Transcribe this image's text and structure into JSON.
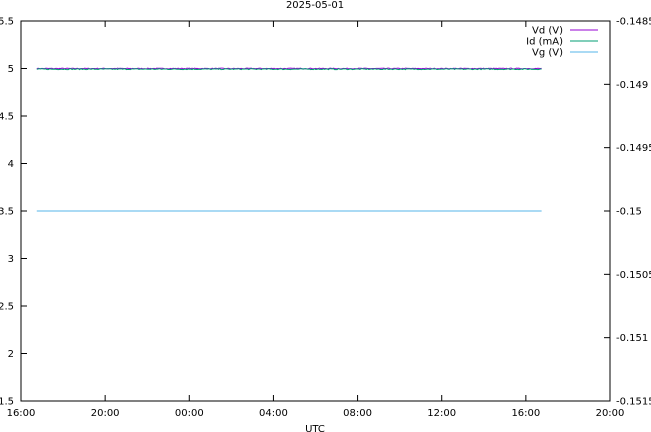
{
  "chart_data": {
    "type": "line",
    "title": "2025-05-01",
    "xlabel": "UTC",
    "x_ticks": [
      "16:00",
      "20:00",
      "00:00",
      "04:00",
      "08:00",
      "12:00",
      "16:00",
      "20:00"
    ],
    "x_range": [
      "2025-04-30T16:00",
      "2025-05-01T20:00"
    ],
    "y_left": {
      "ticks": [
        "1.5",
        "2",
        "2.5",
        "3",
        "3.5",
        "4",
        "4.5",
        "5",
        "5.5"
      ],
      "range": [
        1.5,
        5.5
      ]
    },
    "y_right": {
      "ticks": [
        "-0.1515",
        "-0.151",
        "-0.1505",
        "-0.15",
        "-0.1495",
        "-0.149",
        "-0.1485"
      ],
      "range": [
        -0.1515,
        -0.1485
      ]
    },
    "grid": false,
    "legend_position": "top-right",
    "series": [
      {
        "name": "Vd (V)",
        "axis": "left",
        "color": "#9400d3",
        "x_start": "2025-04-30T16:45",
        "x_end": "2025-05-01T16:45",
        "values": [
          5.0
        ],
        "noise": 0.004
      },
      {
        "name": "Id (mA)",
        "axis": "right",
        "color": "#009e73",
        "x_start": "2025-04-30T16:45",
        "x_end": "2025-05-01T16:45",
        "values": [
          -0.14888
        ],
        "noise": 4e-06
      },
      {
        "name": "Vg (V)",
        "axis": "left",
        "color": "#56b4e9",
        "x_start": "2025-04-30T16:45",
        "x_end": "2025-05-01T16:45",
        "values": [
          3.5
        ],
        "noise": 0
      }
    ]
  }
}
